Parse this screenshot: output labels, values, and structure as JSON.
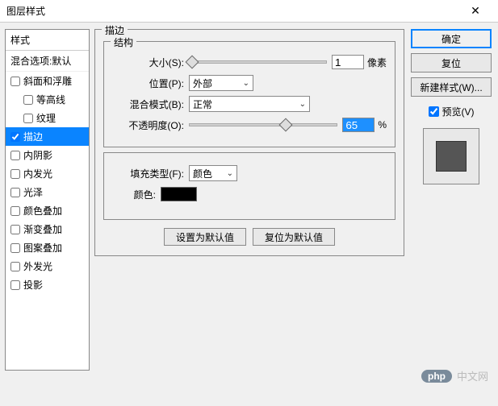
{
  "window": {
    "title": "图层样式"
  },
  "left": {
    "header": "样式",
    "blend_row": "混合选项:默认",
    "items": [
      {
        "label": "斜面和浮雕",
        "indent": false,
        "checked": false
      },
      {
        "label": "等高线",
        "indent": true,
        "checked": false
      },
      {
        "label": "纹理",
        "indent": true,
        "checked": false
      },
      {
        "label": "描边",
        "indent": false,
        "checked": true,
        "selected": true
      },
      {
        "label": "内阴影",
        "indent": false,
        "checked": false
      },
      {
        "label": "内发光",
        "indent": false,
        "checked": false
      },
      {
        "label": "光泽",
        "indent": false,
        "checked": false
      },
      {
        "label": "颜色叠加",
        "indent": false,
        "checked": false
      },
      {
        "label": "渐变叠加",
        "indent": false,
        "checked": false
      },
      {
        "label": "图案叠加",
        "indent": false,
        "checked": false
      },
      {
        "label": "外发光",
        "indent": false,
        "checked": false
      },
      {
        "label": "投影",
        "indent": false,
        "checked": false
      }
    ]
  },
  "middle": {
    "main_legend": "描边",
    "struct_legend": "结构",
    "size_label": "大小(S):",
    "size_value": "1",
    "size_unit": "像素",
    "position_label": "位置(P):",
    "position_value": "外部",
    "blend_label": "混合模式(B):",
    "blend_value": "正常",
    "opacity_label": "不透明度(O):",
    "opacity_value": "65",
    "opacity_unit": "%",
    "fill_group_legend": "",
    "fill_type_label": "填充类型(F):",
    "fill_type_value": "颜色",
    "color_label": "颜色:",
    "color_value": "#000000",
    "reset_default": "设置为默认值",
    "restore_default": "复位为默认值"
  },
  "right": {
    "ok": "确定",
    "cancel": "复位",
    "new_style": "新建样式(W)...",
    "preview_label": "预览(V)",
    "preview_checked": true
  },
  "watermark": {
    "pill": "php",
    "text": "中文网"
  }
}
